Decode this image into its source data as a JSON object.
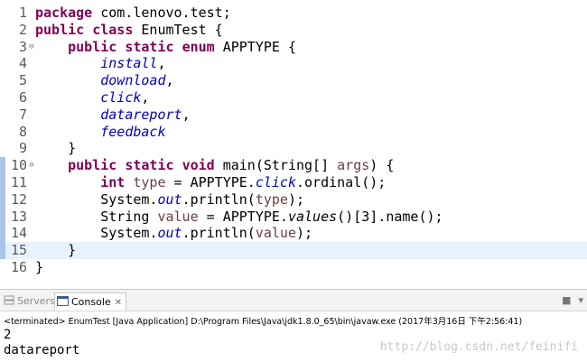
{
  "editor": {
    "line_numbers": [
      "1",
      "2",
      "3",
      "4",
      "5",
      "6",
      "7",
      "8",
      "9",
      "10",
      "11",
      "12",
      "13",
      "14",
      "15",
      "16"
    ],
    "tokens": {
      "package": "package",
      "package_name": " com.lenovo.test;",
      "public": "public",
      "class": "class",
      "static": "static",
      "enum": "enum",
      "void": "void",
      "int": "int",
      "class_decl": " EnumTest {",
      "enum_decl": " APPTYPE {",
      "install": "install",
      "download": "download",
      "click": "click",
      "datareport": "datareport",
      "feedback": "feedback",
      "comma": ",",
      "close_brace": "}",
      "main_decl_1": " main(String[] ",
      "args": "args",
      "main_decl_2": ") {",
      "type": "type",
      "assign_apptype": " = APPTYPE.",
      "ordinal_call": ".ordinal();",
      "system": "System.",
      "out": "out",
      "println_open": ".println(",
      "close_paren_semi": ");",
      "string_type": "String ",
      "value": "value",
      "values": "values",
      "index_name": "()[3].name();"
    }
  },
  "console": {
    "tabs": {
      "servers": "Servers",
      "console": "Console"
    },
    "close_glyph": "✕",
    "toolbar_icons": [
      "terminate-icon",
      "view-menu-icon"
    ],
    "process_label": "<terminated> EnumTest [Java Application] D:\\Program Files\\Java\\jdk1.8.0_65\\bin\\javaw.exe (2017年3月16日 下午2:56:41)",
    "output": [
      "2",
      "datareport"
    ]
  },
  "watermark": "http://blog.csdn.net/feinifi",
  "colors": {
    "keyword": "#7f0055",
    "enum_constant": "#0000c0",
    "local_variable": "#6a3e3e",
    "current_line": "#e8f2fe",
    "line_marker": "#a9c4e8"
  }
}
